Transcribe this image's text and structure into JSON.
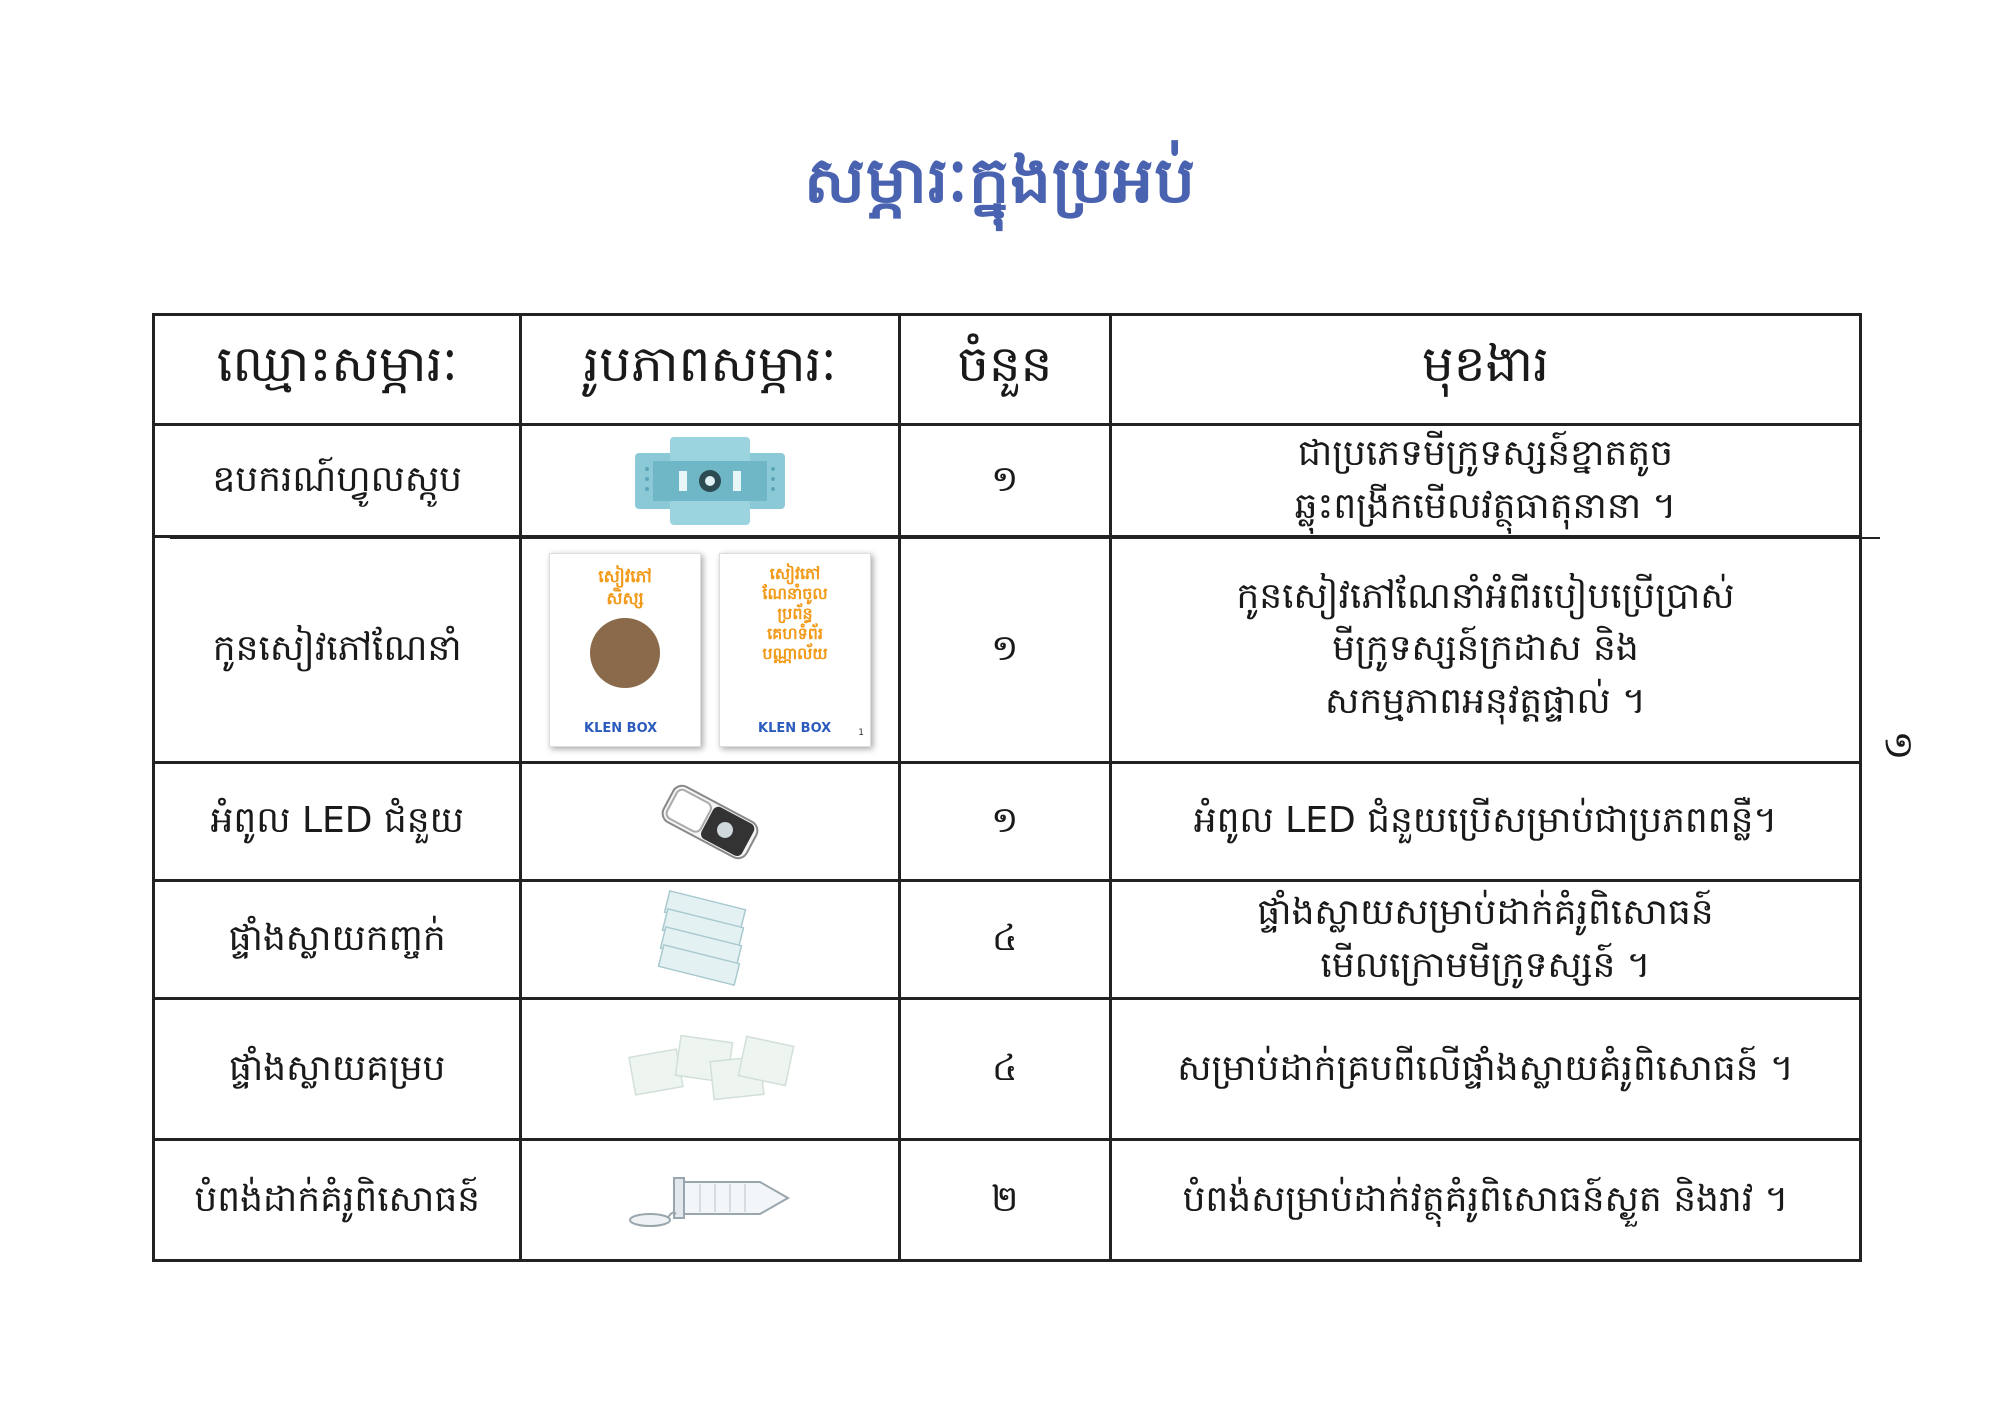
{
  "title": "សម្ភារៈក្នុងប្រអប់",
  "headers": {
    "name": "ឈ្មោះសម្ភារៈ",
    "image": "រូបភាពសម្ភារៈ",
    "quantity": "ចំនួន",
    "function": "មុខងារ"
  },
  "rows": [
    {
      "name": "ឧបករណ៍ហ្វូលស្កូប",
      "quantity": "១",
      "function_lines": [
        "ជាប្រភេទមីក្រូទស្សន៍ខ្នាតតូច",
        "ឆ្លុះពង្រីកមើលវត្ថុធាតុនានា ។"
      ],
      "image_icon": "foldscope-icon"
    },
    {
      "name": "កូនសៀវភៅណែនាំ",
      "quantity": "១",
      "function_lines": [
        "កូនសៀវភៅណែនាំអំពីរបៀបប្រើប្រាស់",
        "មីក្រូទស្សន៍ក្រដាស និង",
        "សកម្មភាពអនុវត្តផ្ទាល់ ។"
      ],
      "image_icon": "booklets-icon",
      "booklet_left": {
        "line1": "សៀវភៅ",
        "line2": "សិស្ស",
        "brand": "KLEN BOX"
      },
      "booklet_right": {
        "line1": "សៀវភៅ",
        "line2": "ណែនាំចូល",
        "line3": "ប្រព័ន្ធ",
        "line4": "គេហទំព័រ",
        "line5": "បណ្ណាល័យ",
        "brand": "KLEN BOX",
        "page": "1"
      }
    },
    {
      "name": "អំពូល LED ជំនួយ",
      "quantity": "១",
      "function_lines": [
        "អំពូល LED ជំនួយប្រើសម្រាប់ជាប្រភពពន្លឺ។"
      ],
      "image_icon": "led-clip-icon"
    },
    {
      "name": "ផ្ទាំងស្លាយកញ្ចក់",
      "quantity": "៤",
      "function_lines": [
        "ផ្ទាំងស្លាយសម្រាប់ដាក់គំរូពិសោធន៍",
        "មើលក្រោមមីក្រូទស្សន៍ ។"
      ],
      "image_icon": "glass-slides-icon"
    },
    {
      "name": "ផ្ទាំងស្លាយគម្រប",
      "quantity": "៤",
      "function_lines": [
        "សម្រាប់ដាក់គ្របពីលើផ្ទាំងស្លាយគំរូពិសោធន៍ ។"
      ],
      "image_icon": "cover-slips-icon"
    },
    {
      "name": "បំពង់ដាក់គំរូពិសោធន៍",
      "quantity": "២",
      "function_lines": [
        "បំពង់សម្រាប់ដាក់វត្ថុគំរូពិសោធន៍ស្ងួត និងរាវ ។"
      ],
      "image_icon": "sample-tube-icon"
    }
  ],
  "page_number": "១"
}
